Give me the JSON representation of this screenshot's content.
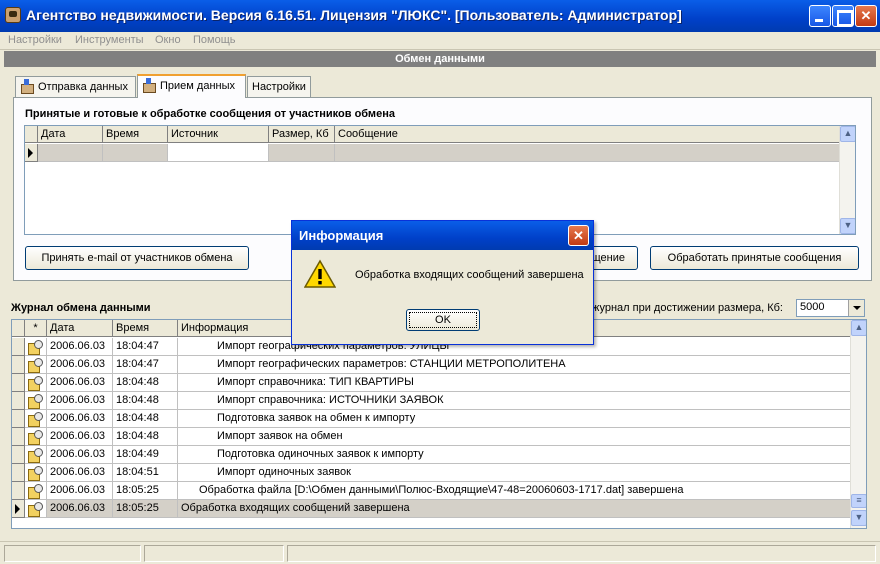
{
  "window": {
    "title": "Агентство недвижимости. Версия 6.16.51. Лицензия \"ЛЮКС\". [Пользователь: Администратор]",
    "minimize": "_",
    "maximize": "□",
    "close": "✕"
  },
  "menu": {
    "items": [
      {
        "label": "Настройки"
      },
      {
        "label": "Инструменты"
      },
      {
        "label": "Окно"
      },
      {
        "label": "Помощь"
      }
    ]
  },
  "panel": {
    "title": "Обмен данными"
  },
  "tabs": [
    {
      "label": "Отправка данных",
      "icon": "send-data-icon"
    },
    {
      "label": "Прием данных",
      "icon": "receive-data-icon",
      "active": true
    },
    {
      "label": "Настройки"
    }
  ],
  "inbox": {
    "title": "Принятые и готовые к обработке сообщения от участников обмена",
    "columns": [
      "Дата",
      "Время",
      "Источник",
      "Размер, Кб",
      "Сообщение"
    ],
    "rows": [
      [
        "",
        "",
        "",
        "",
        ""
      ]
    ]
  },
  "buttons": {
    "receive_email": "Принять e-mail от участников обмена",
    "hidden_partial": "щение",
    "process": "Обработать принятые сообщения"
  },
  "log": {
    "title": "Журнал обмена данными",
    "clear_label_partial": "журнал при достижении размера, Кб:",
    "size_value": "5000",
    "columns": [
      "*",
      "Дата",
      "Время",
      "Информация"
    ],
    "rows": [
      {
        "date": "2006.06.03",
        "time": "18:04:47",
        "info": "Импорт географических параметров: УЛИЦЫ",
        "indent": 2
      },
      {
        "date": "2006.06.03",
        "time": "18:04:47",
        "info": "Импорт географических параметров: СТАНЦИИ МЕТРОПОЛИТЕНА",
        "indent": 2
      },
      {
        "date": "2006.06.03",
        "time": "18:04:48",
        "info": "Импорт справочника: ТИП КВАРТИРЫ",
        "indent": 2
      },
      {
        "date": "2006.06.03",
        "time": "18:04:48",
        "info": "Импорт справочника: ИСТОЧНИКИ ЗАЯВОК",
        "indent": 2
      },
      {
        "date": "2006.06.03",
        "time": "18:04:48",
        "info": "Подготовка заявок на обмен к импорту",
        "indent": 2
      },
      {
        "date": "2006.06.03",
        "time": "18:04:48",
        "info": "Импорт заявок на обмен",
        "indent": 2
      },
      {
        "date": "2006.06.03",
        "time": "18:04:49",
        "info": "Подготовка одиночных заявок к импорту",
        "indent": 2
      },
      {
        "date": "2006.06.03",
        "time": "18:04:51",
        "info": "Импорт одиночных заявок",
        "indent": 2
      },
      {
        "date": "2006.06.03",
        "time": "18:05:25",
        "info": "Обработка файла [D:\\Обмен данными\\Полюс-Входящие\\47-48=20060603-1717.dat] завершена",
        "indent": 1
      },
      {
        "date": "2006.06.03",
        "time": "18:05:25",
        "info": "Обработка входящих сообщений завершена",
        "indent": 0,
        "selected": true
      }
    ]
  },
  "dialog": {
    "title": "Информация",
    "message": "Обработка входящих сообщений завершена",
    "ok": "OK",
    "close": "✕",
    "icon": "warning-icon"
  }
}
